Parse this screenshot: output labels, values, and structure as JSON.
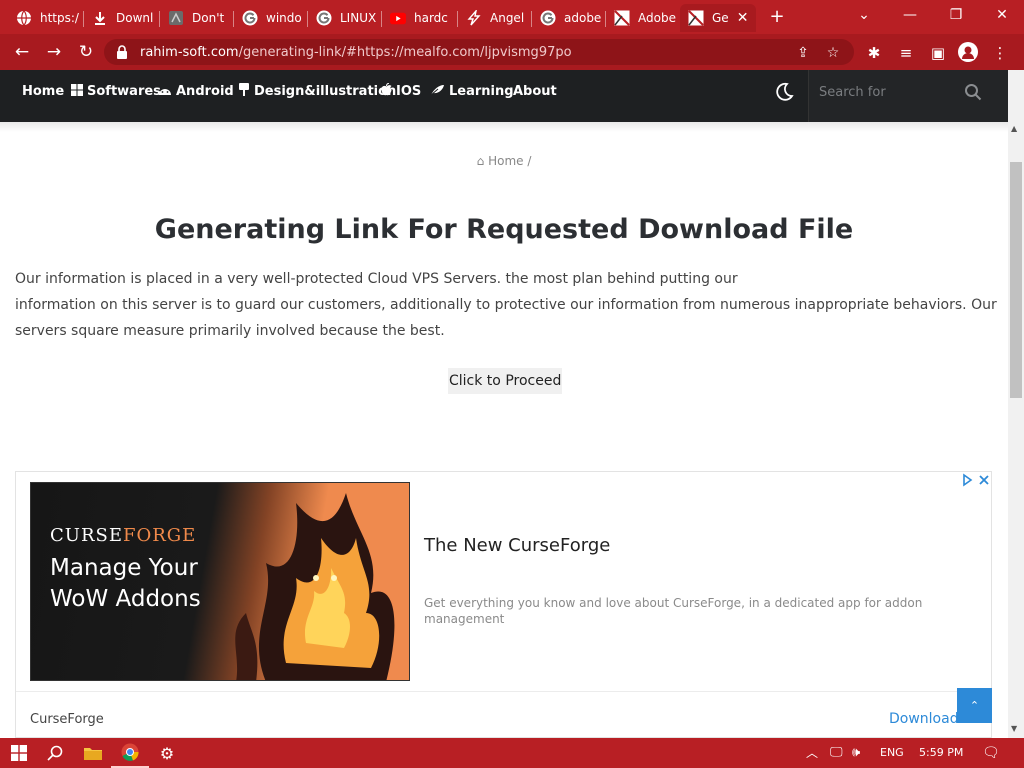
{
  "browser": {
    "tabs": [
      {
        "label": "https:/",
        "icon": "globe-icon"
      },
      {
        "label": "Downl",
        "icon": "download-icon"
      },
      {
        "label": "Don't",
        "icon": "site-icon"
      },
      {
        "label": "windo",
        "icon": "google-icon"
      },
      {
        "label": "LINUX",
        "icon": "google-icon"
      },
      {
        "label": "hardc",
        "icon": "youtube-icon"
      },
      {
        "label": "Angel",
        "icon": "bolt-icon"
      },
      {
        "label": "adobe",
        "icon": "google-icon"
      },
      {
        "label": "Adobe",
        "icon": "site-icon"
      },
      {
        "label": "Ge",
        "icon": "site-icon"
      }
    ],
    "active_tab_index": 9,
    "new_tab_label": "+",
    "url": {
      "host": "rahim-soft.com",
      "path": "/generating-link/#https://mealfo.com/ljpvismg97po"
    }
  },
  "site": {
    "nav": [
      {
        "label": "Home",
        "icon": ""
      },
      {
        "label": "Softwares",
        "icon": "windows-icon"
      },
      {
        "label": "Android",
        "icon": "android-icon"
      },
      {
        "label": "Design&illustration",
        "icon": "brush-icon"
      },
      {
        "label": "IOS",
        "icon": "apple-icon"
      },
      {
        "label": "Learning",
        "icon": "feather-icon"
      },
      {
        "label": "About",
        "icon": ""
      }
    ],
    "search_placeholder": "Search for",
    "breadcrumb": "Home /",
    "title": "Generating Link For Requested Download File",
    "paragraph_line1": "Our information is placed in a very well-protected Cloud VPS Servers. the most plan behind putting our",
    "paragraph_rest": "information on this server is to guard our customers, additionally to protective our information from numerous inappropriate behaviors. Our servers square measure primarily involved because the best.",
    "proceed_label": "Click to Proceed"
  },
  "ad": {
    "brand_part1": "CURSE",
    "brand_part2": "FORGE",
    "slogan_line1": "Manage Your",
    "slogan_line2": "WoW Addons",
    "headline": "The New CurseForge",
    "description": "Get everything you know and love about CurseForge, in a dedicated app for addon management",
    "advertiser": "CurseForge",
    "cta": "Download",
    "accent_color": "#2d8ad8"
  },
  "taskbar": {
    "language": "ENG",
    "time": "5:59 PM"
  },
  "colors": {
    "browser_red": "#b81f24",
    "nav_dark": "#1e2022"
  }
}
